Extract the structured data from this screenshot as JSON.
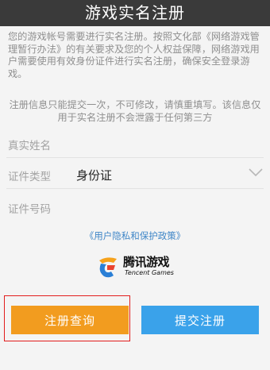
{
  "header": {
    "title": "游戏实名注册"
  },
  "intro": {
    "text": "您的游戏帐号需要进行实名注册。按照文化部《网络游戏管理暂行办法》的有关要求及您的个人权益保障，网络游戏用户需要使用有效身份证件进行实名注册，确保安全登录游戏。"
  },
  "notice": {
    "text": "注册信息只能提交一次，不可修改，请慎重填写。该信息仅用于实名注册不会泄露于任何第三方"
  },
  "form": {
    "name_label": "真实姓名",
    "name_value": "",
    "idtype_label": "证件类型",
    "idtype_value": "身份证",
    "idnum_label": "证件号码",
    "idnum_value": ""
  },
  "privacy_link": "《用户隐私和保护政策》",
  "logo": {
    "title": "腾讯游戏",
    "subtitle": "Tencent Games"
  },
  "buttons": {
    "query": "注册查询",
    "submit": "提交注册"
  },
  "colors": {
    "header_bg": "#3a3a3a",
    "query_button": "#f29c1f",
    "submit_button": "#3aa2ea",
    "link": "#3f86c7",
    "highlight": "#e21d1d"
  }
}
